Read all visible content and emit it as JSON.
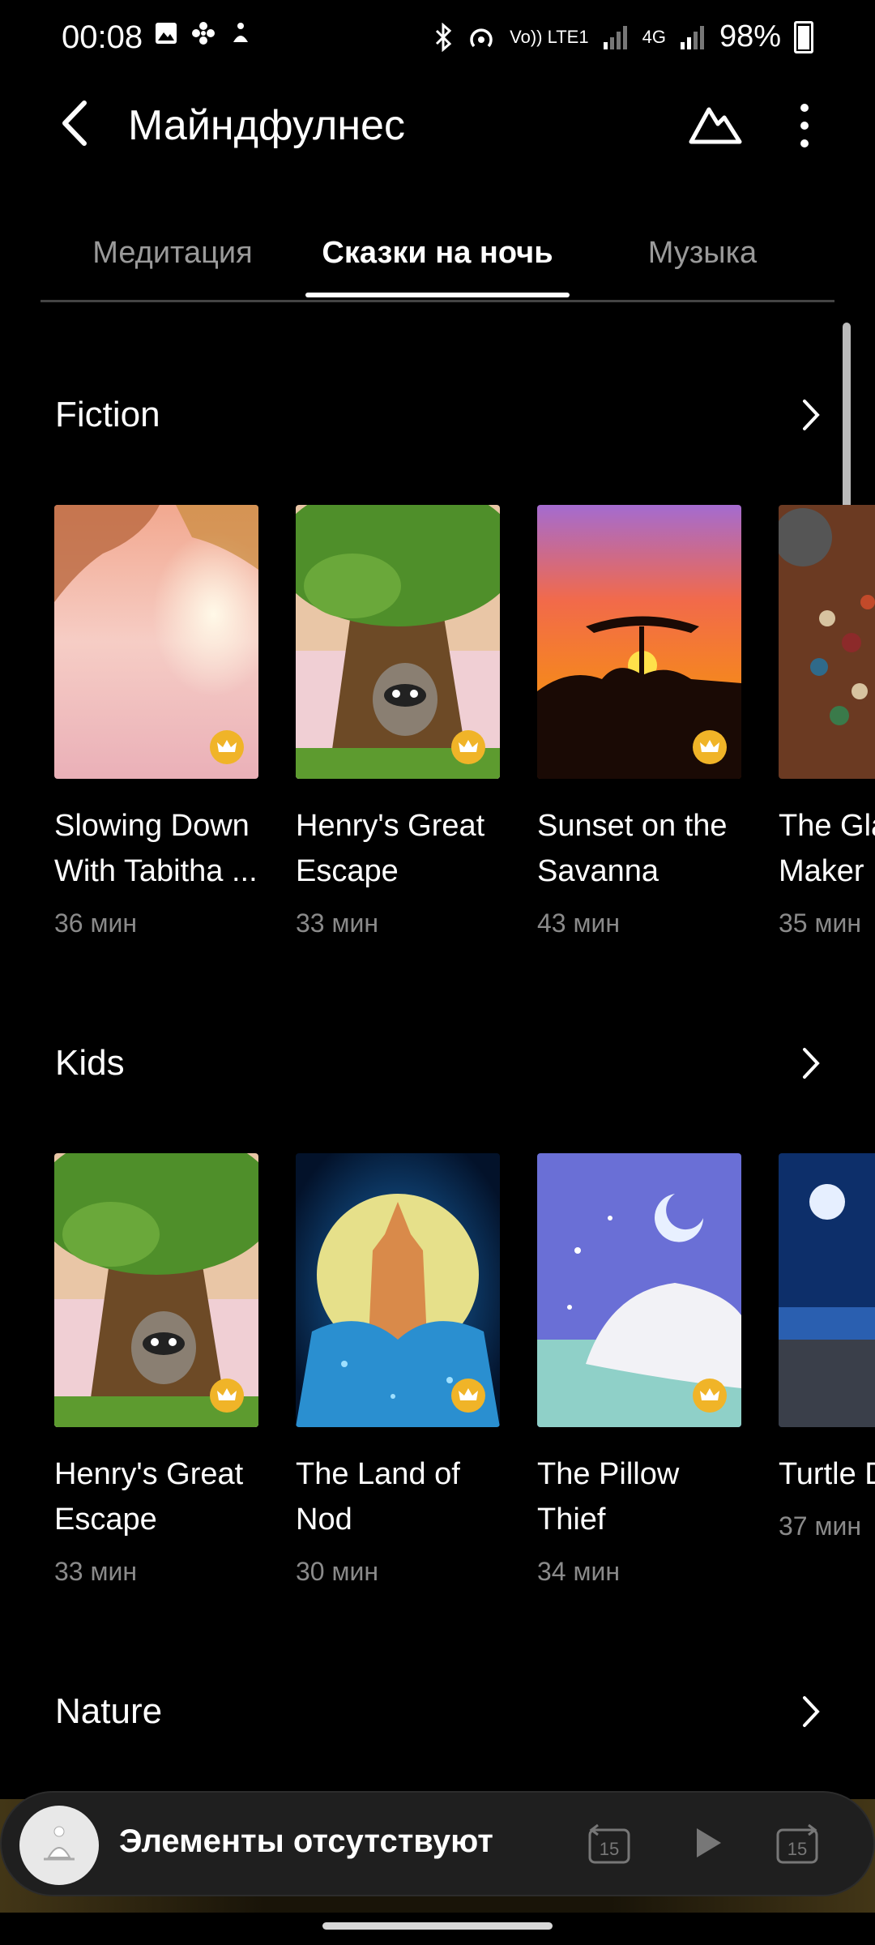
{
  "status": {
    "time": "00:08",
    "volte": "Vo)) LTE1",
    "network": "4G",
    "battery": "98%"
  },
  "appbar": {
    "title": "Майндфулнес"
  },
  "tabs": [
    {
      "label": "Медитация"
    },
    {
      "label": "Сказки на ночь"
    },
    {
      "label": "Музыка"
    }
  ],
  "sections": [
    {
      "title": "Fiction",
      "items": [
        {
          "title1": "Slowing Down",
          "title2": "With Tabitha ...",
          "duration": "36 мин"
        },
        {
          "title1": "Henry's Great",
          "title2": "Escape",
          "duration": "33 мин"
        },
        {
          "title1": "Sunset on the",
          "title2": "Savanna",
          "duration": "43 мин"
        },
        {
          "title1": "The Gla",
          "title2": "Maker",
          "duration": "35 мин"
        }
      ]
    },
    {
      "title": "Kids",
      "items": [
        {
          "title1": "Henry's Great",
          "title2": "Escape",
          "duration": "33 мин"
        },
        {
          "title1": "The Land of",
          "title2": "Nod",
          "duration": "30 мин"
        },
        {
          "title1": "The Pillow",
          "title2": "Thief",
          "duration": "34 мин"
        },
        {
          "title1": "Turtle D",
          "title2": "",
          "duration": "37 мин"
        }
      ]
    },
    {
      "title": "Nature"
    }
  ],
  "player": {
    "text": "Элементы отсутствуют",
    "rewind_label": "15",
    "forward_label": "15"
  },
  "icons": {
    "back": "chevron-left-icon",
    "mountain": "mountain-icon",
    "more": "kebab-icon",
    "arrow": "chevron-right-icon",
    "premium": "crown-icon",
    "play": "play-icon"
  },
  "colors": {
    "background": "#000000",
    "premium_badge": "#f0b428",
    "duration_text": "#8a8a8a"
  }
}
